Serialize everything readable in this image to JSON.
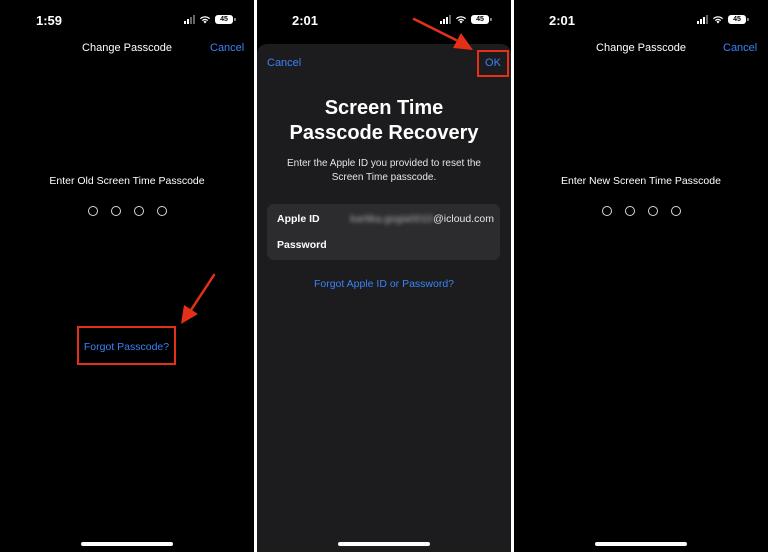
{
  "colors": {
    "accent": "#3b82f6",
    "highlight": "#e53018",
    "background": "#000000",
    "sheet": "#1c1c1e"
  },
  "screen1": {
    "time": "1:59",
    "battery": "45",
    "nav_title": "Change Passcode",
    "cancel": "Cancel",
    "prompt": "Enter Old Screen Time Passcode",
    "forgot_link": "Forgot Passcode?"
  },
  "screen2": {
    "time": "2:01",
    "battery": "45",
    "cancel": "Cancel",
    "ok": "OK",
    "title_line1": "Screen Time",
    "title_line2": "Passcode Recovery",
    "description": "Enter the Apple ID you provided to reset the Screen Time passcode.",
    "apple_id_label": "Apple ID",
    "apple_id_blurred": "kartika.gogia0010",
    "apple_id_domain": "@icloud.com",
    "password_label": "Password",
    "forgot_link": "Forgot Apple ID or Password?"
  },
  "screen3": {
    "time": "2:01",
    "battery": "45",
    "nav_title": "Change Passcode",
    "cancel": "Cancel",
    "prompt": "Enter New Screen Time Passcode"
  }
}
